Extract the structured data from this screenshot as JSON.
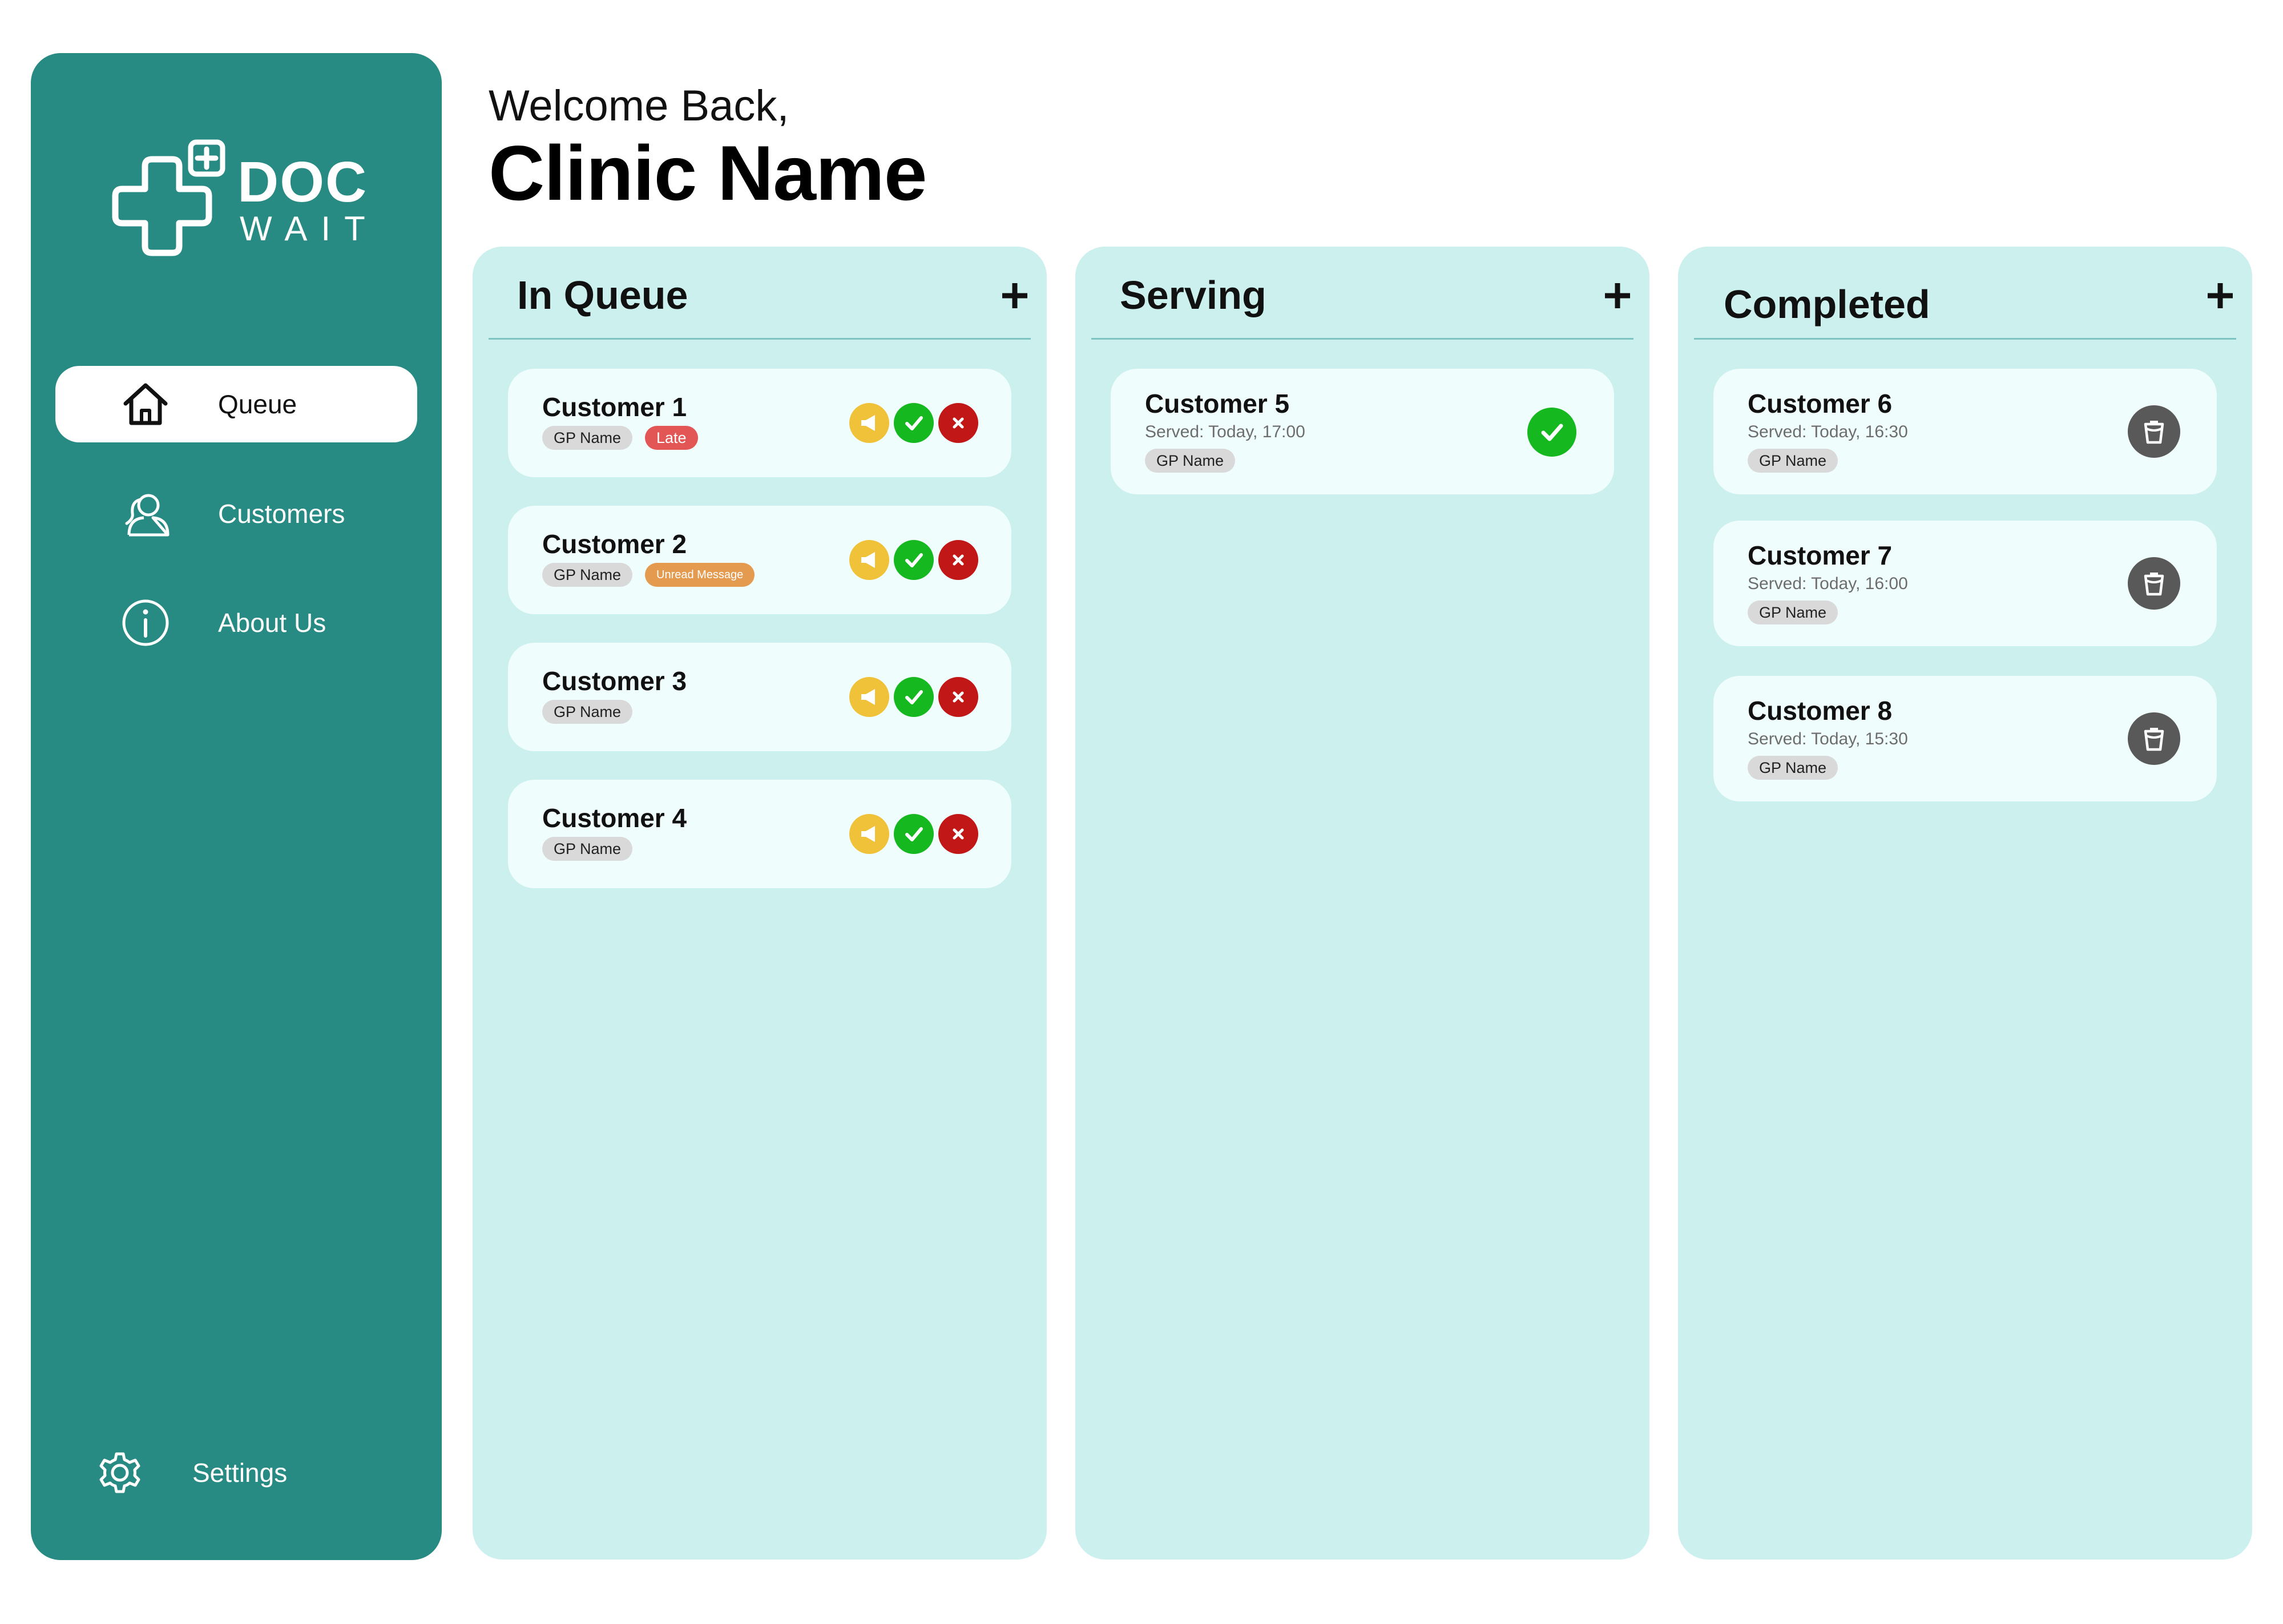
{
  "brand": {
    "line1": "DOC",
    "line2": "WAIT"
  },
  "sidebar": {
    "items": [
      {
        "label": "Queue",
        "icon": "home-icon",
        "active": true
      },
      {
        "label": "Customers",
        "icon": "users-icon"
      },
      {
        "label": "About Us",
        "icon": "info-icon"
      }
    ],
    "settings_label": "Settings"
  },
  "header": {
    "welcome": "Welcome Back,",
    "clinic": "Clinic Name"
  },
  "columns": {
    "queue": {
      "title": "In Queue",
      "cards": [
        {
          "name": "Customer 1",
          "gp": "GP Name",
          "badge": "Late"
        },
        {
          "name": "Customer 2",
          "gp": "GP Name",
          "badge": "Unread Message"
        },
        {
          "name": "Customer 3",
          "gp": "GP Name"
        },
        {
          "name": "Customer 4",
          "gp": "GP Name"
        }
      ]
    },
    "serving": {
      "title": "Serving",
      "cards": [
        {
          "name": "Customer 5",
          "served": "Served: Today, 17:00",
          "gp": "GP Name"
        }
      ]
    },
    "completed": {
      "title": "Completed",
      "cards": [
        {
          "name": "Customer 6",
          "served": "Served: Today, 16:30",
          "gp": "GP Name"
        },
        {
          "name": "Customer 7",
          "served": "Served: Today, 16:00",
          "gp": "GP Name"
        },
        {
          "name": "Customer 8",
          "served": "Served: Today, 15:30",
          "gp": "GP Name"
        }
      ]
    }
  },
  "colors": {
    "sidebar": "#288b83",
    "column_bg": "#cbf0ee",
    "card_bg": "#effdfc",
    "late": "#e25656",
    "unread": "#e49a4f",
    "notify": "#f0c23a",
    "accept": "#16b820",
    "reject": "#c21717",
    "trash": "#595959"
  }
}
